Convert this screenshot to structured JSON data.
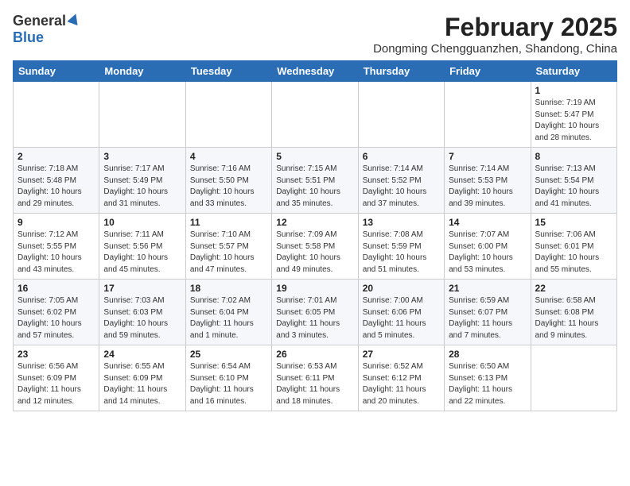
{
  "header": {
    "logo_general": "General",
    "logo_blue": "Blue",
    "month_year": "February 2025",
    "location": "Dongming Chengguanzhen, Shandong, China"
  },
  "weekdays": [
    "Sunday",
    "Monday",
    "Tuesday",
    "Wednesday",
    "Thursday",
    "Friday",
    "Saturday"
  ],
  "weeks": [
    [
      {
        "day": "",
        "info": ""
      },
      {
        "day": "",
        "info": ""
      },
      {
        "day": "",
        "info": ""
      },
      {
        "day": "",
        "info": ""
      },
      {
        "day": "",
        "info": ""
      },
      {
        "day": "",
        "info": ""
      },
      {
        "day": "1",
        "info": "Sunrise: 7:19 AM\nSunset: 5:47 PM\nDaylight: 10 hours\nand 28 minutes."
      }
    ],
    [
      {
        "day": "2",
        "info": "Sunrise: 7:18 AM\nSunset: 5:48 PM\nDaylight: 10 hours\nand 29 minutes."
      },
      {
        "day": "3",
        "info": "Sunrise: 7:17 AM\nSunset: 5:49 PM\nDaylight: 10 hours\nand 31 minutes."
      },
      {
        "day": "4",
        "info": "Sunrise: 7:16 AM\nSunset: 5:50 PM\nDaylight: 10 hours\nand 33 minutes."
      },
      {
        "day": "5",
        "info": "Sunrise: 7:15 AM\nSunset: 5:51 PM\nDaylight: 10 hours\nand 35 minutes."
      },
      {
        "day": "6",
        "info": "Sunrise: 7:14 AM\nSunset: 5:52 PM\nDaylight: 10 hours\nand 37 minutes."
      },
      {
        "day": "7",
        "info": "Sunrise: 7:14 AM\nSunset: 5:53 PM\nDaylight: 10 hours\nand 39 minutes."
      },
      {
        "day": "8",
        "info": "Sunrise: 7:13 AM\nSunset: 5:54 PM\nDaylight: 10 hours\nand 41 minutes."
      }
    ],
    [
      {
        "day": "9",
        "info": "Sunrise: 7:12 AM\nSunset: 5:55 PM\nDaylight: 10 hours\nand 43 minutes."
      },
      {
        "day": "10",
        "info": "Sunrise: 7:11 AM\nSunset: 5:56 PM\nDaylight: 10 hours\nand 45 minutes."
      },
      {
        "day": "11",
        "info": "Sunrise: 7:10 AM\nSunset: 5:57 PM\nDaylight: 10 hours\nand 47 minutes."
      },
      {
        "day": "12",
        "info": "Sunrise: 7:09 AM\nSunset: 5:58 PM\nDaylight: 10 hours\nand 49 minutes."
      },
      {
        "day": "13",
        "info": "Sunrise: 7:08 AM\nSunset: 5:59 PM\nDaylight: 10 hours\nand 51 minutes."
      },
      {
        "day": "14",
        "info": "Sunrise: 7:07 AM\nSunset: 6:00 PM\nDaylight: 10 hours\nand 53 minutes."
      },
      {
        "day": "15",
        "info": "Sunrise: 7:06 AM\nSunset: 6:01 PM\nDaylight: 10 hours\nand 55 minutes."
      }
    ],
    [
      {
        "day": "16",
        "info": "Sunrise: 7:05 AM\nSunset: 6:02 PM\nDaylight: 10 hours\nand 57 minutes."
      },
      {
        "day": "17",
        "info": "Sunrise: 7:03 AM\nSunset: 6:03 PM\nDaylight: 10 hours\nand 59 minutes."
      },
      {
        "day": "18",
        "info": "Sunrise: 7:02 AM\nSunset: 6:04 PM\nDaylight: 11 hours\nand 1 minute."
      },
      {
        "day": "19",
        "info": "Sunrise: 7:01 AM\nSunset: 6:05 PM\nDaylight: 11 hours\nand 3 minutes."
      },
      {
        "day": "20",
        "info": "Sunrise: 7:00 AM\nSunset: 6:06 PM\nDaylight: 11 hours\nand 5 minutes."
      },
      {
        "day": "21",
        "info": "Sunrise: 6:59 AM\nSunset: 6:07 PM\nDaylight: 11 hours\nand 7 minutes."
      },
      {
        "day": "22",
        "info": "Sunrise: 6:58 AM\nSunset: 6:08 PM\nDaylight: 11 hours\nand 9 minutes."
      }
    ],
    [
      {
        "day": "23",
        "info": "Sunrise: 6:56 AM\nSunset: 6:09 PM\nDaylight: 11 hours\nand 12 minutes."
      },
      {
        "day": "24",
        "info": "Sunrise: 6:55 AM\nSunset: 6:09 PM\nDaylight: 11 hours\nand 14 minutes."
      },
      {
        "day": "25",
        "info": "Sunrise: 6:54 AM\nSunset: 6:10 PM\nDaylight: 11 hours\nand 16 minutes."
      },
      {
        "day": "26",
        "info": "Sunrise: 6:53 AM\nSunset: 6:11 PM\nDaylight: 11 hours\nand 18 minutes."
      },
      {
        "day": "27",
        "info": "Sunrise: 6:52 AM\nSunset: 6:12 PM\nDaylight: 11 hours\nand 20 minutes."
      },
      {
        "day": "28",
        "info": "Sunrise: 6:50 AM\nSunset: 6:13 PM\nDaylight: 11 hours\nand 22 minutes."
      },
      {
        "day": "",
        "info": ""
      }
    ]
  ]
}
